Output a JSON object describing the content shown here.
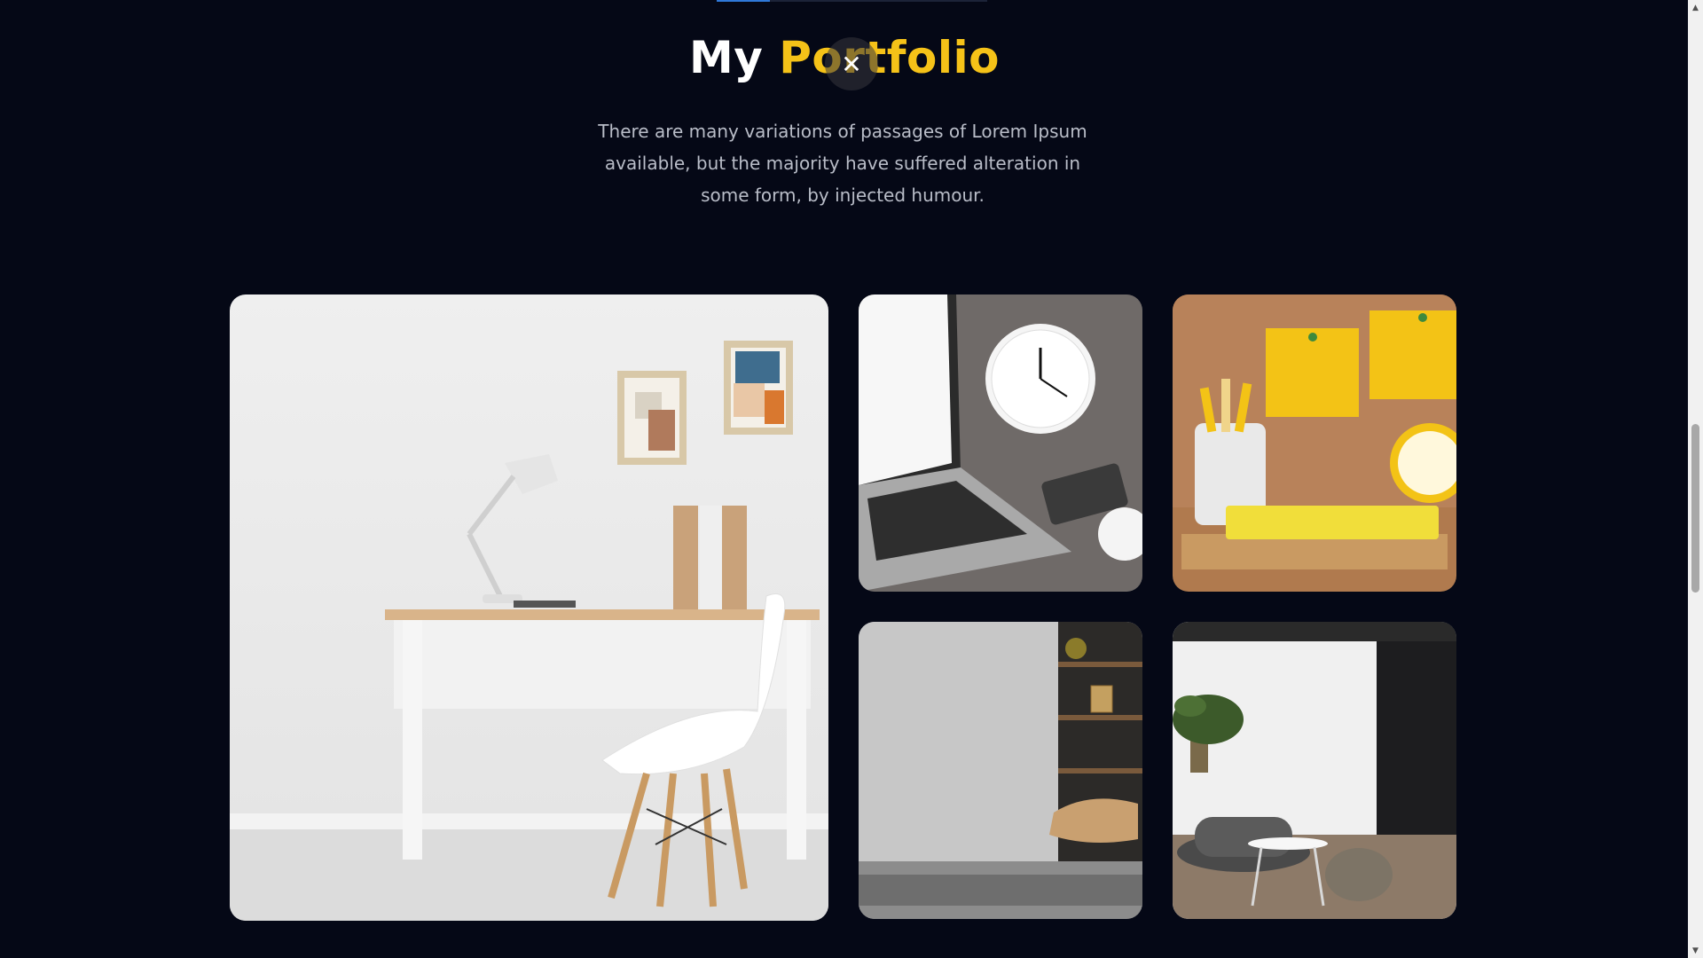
{
  "portfolio": {
    "title_part1": "My ",
    "title_part2": "Portfolio",
    "description": "There are many variations of passages of Lorem Ipsum available, but the majority have suffered alteration in some form, by injected humour.",
    "close_symbol": "✕",
    "images": [
      {
        "subject": "white desk with lamp and chair"
      },
      {
        "subject": "laptop with alarm clock"
      },
      {
        "subject": "yellow sticky notes on cork board"
      },
      {
        "subject": "concrete wall with armchair"
      },
      {
        "subject": "living room with plant and sofa"
      }
    ]
  },
  "colors": {
    "background": "#050816",
    "accent": "#f5c218",
    "text": "#ffffff",
    "muted_text": "#b9bdc8"
  },
  "icons": {
    "close": "close-icon",
    "scroll_up": "arrow-up-icon",
    "scroll_down": "arrow-down-icon"
  }
}
